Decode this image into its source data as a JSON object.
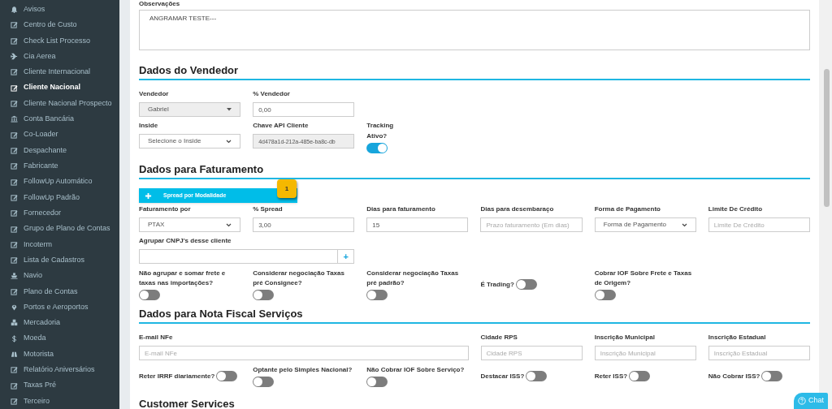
{
  "sidebar": {
    "items": [
      {
        "label": "Avisos",
        "kind": "bell",
        "selected": false
      },
      {
        "label": "Centro de Custo",
        "kind": "edit",
        "selected": false
      },
      {
        "label": "Check List Processo",
        "kind": "edit",
        "selected": false
      },
      {
        "label": "Cia Aerea",
        "kind": "plane",
        "selected": false
      },
      {
        "label": "Cliente Internacional",
        "kind": "edit",
        "selected": false
      },
      {
        "label": "Cliente Nacional",
        "kind": "edit",
        "selected": true
      },
      {
        "label": "Cliente Nacional Prospecto",
        "kind": "edit",
        "selected": false
      },
      {
        "label": "Conta Bancária",
        "kind": "bank",
        "selected": false
      },
      {
        "label": "Co-Loader",
        "kind": "edit",
        "selected": false
      },
      {
        "label": "Despachante",
        "kind": "edit",
        "selected": false
      },
      {
        "label": "Fabricante",
        "kind": "edit",
        "selected": false
      },
      {
        "label": "FollowUp Automático",
        "kind": "edit",
        "selected": false
      },
      {
        "label": "FollowUp Padrão",
        "kind": "edit",
        "selected": false
      },
      {
        "label": "Fornecedor",
        "kind": "edit",
        "selected": false
      },
      {
        "label": "Grupo de Plano de Contas",
        "kind": "edit",
        "selected": false
      },
      {
        "label": "Incoterm",
        "kind": "edit",
        "selected": false
      },
      {
        "label": "Lista de Cadastros",
        "kind": "edit",
        "selected": false
      },
      {
        "label": "Navio",
        "kind": "ship",
        "selected": false
      },
      {
        "label": "Plano de Contas",
        "kind": "edit",
        "selected": false
      },
      {
        "label": "Portos e Aeroportos",
        "kind": "pin",
        "selected": false
      },
      {
        "label": "Mercadoria",
        "kind": "cubes",
        "selected": false
      },
      {
        "label": "Moeda",
        "kind": "dollar",
        "selected": false
      },
      {
        "label": "Motorista",
        "kind": "binoculars",
        "selected": false
      },
      {
        "label": "Relatório Aniversários",
        "kind": "edit",
        "selected": false
      },
      {
        "label": "Taxas Pré",
        "kind": "edit",
        "selected": false
      },
      {
        "label": "Terceiro",
        "kind": "edit",
        "selected": false
      }
    ]
  },
  "observacoes": {
    "label": "Observações",
    "value": "ANGRAMAR TESTE---"
  },
  "sections": [
    {
      "title": "Dados do Vendedor",
      "rows": [
        [
          {
            "kind": "select",
            "label": "Vendedor",
            "value": "Gabriel",
            "disabled": true
          },
          {
            "kind": "input",
            "label": "% Vendedor",
            "value": "0,00",
            "disabled": false
          }
        ],
        [
          {
            "kind": "select",
            "label": "Inside",
            "value": "Selecione o Inside",
            "disabled": false
          },
          {
            "kind": "input",
            "label": "Chave API Cliente",
            "value": "4d478a1d-212a-485e-ba8c-db",
            "disabled": true
          },
          {
            "kind": "toggle",
            "label": "Tracking Ativo?",
            "on": true
          }
        ]
      ]
    },
    {
      "title": "Dados para Faturamento",
      "button": {
        "label": "Spread por Modalidade",
        "badge": "1"
      },
      "rows": [
        [
          {
            "kind": "select",
            "label": "Faturamento por",
            "value": "PTAX",
            "disabled": false
          },
          {
            "kind": "input",
            "label": "% Spread",
            "value": "3,00",
            "disabled": false
          },
          {
            "kind": "input",
            "label": "Dias para faturamento",
            "value": "15",
            "disabled": false
          },
          {
            "kind": "input",
            "label": "Dias para desembaraço",
            "placeholder": "Prazo faturamento (Em dias)",
            "disabled": false
          },
          {
            "kind": "select",
            "label": "Forma de Pagamento",
            "value": "Forma de Pagamento",
            "disabled": false
          },
          {
            "kind": "input",
            "label": "Limite De Crédito",
            "placeholder": "Limite De Crédito",
            "disabled": false
          }
        ],
        [
          {
            "kind": "addon",
            "label": "Agrupar CNPJ's desse cliente",
            "addon": "+"
          }
        ],
        [
          {
            "kind": "toggle",
            "label": "Não agrupar e somar frete e taxas nas importações?",
            "on": false
          },
          {
            "kind": "toggle",
            "label": "Considerar negociação Taxas pré Consignee?",
            "on": false
          },
          {
            "kind": "toggle",
            "label": "Considerar negociação Taxas pré padrão?",
            "on": false
          },
          {
            "kind": "toggle-inline",
            "label": "É Trading?",
            "on": false
          },
          {
            "kind": "toggle",
            "label": "Cobrar IOF Sobre Frete e Taxas de Origem?",
            "on": false
          }
        ]
      ]
    },
    {
      "title": "Dados para Nota Fiscal Serviços",
      "rows": [
        [
          {
            "kind": "input",
            "label": "E-mail NFe",
            "placeholder": "E-mail NFe",
            "disabled": false
          },
          "",
          "",
          {
            "kind": "input",
            "label": "Cidade RPS",
            "placeholder": "Cidade RPS",
            "disabled": false
          },
          {
            "kind": "input",
            "label": "Inscrição Municipal",
            "placeholder": "Inscrição Municipal",
            "disabled": false
          },
          {
            "kind": "input",
            "label": "Inscrição Estadual",
            "placeholder": "Inscrição Estadual",
            "disabled": false
          }
        ],
        [
          {
            "kind": "toggle-inline",
            "label": "Reter IRRF diariamente?",
            "on": false
          },
          {
            "kind": "toggle",
            "label": "Optante pelo Simples Nacional?",
            "on": false
          },
          {
            "kind": "toggle",
            "label": "Não Cobrar IOF Sobre Serviço?",
            "on": false
          },
          {
            "kind": "toggle-inline",
            "label": "Destacar ISS?",
            "on": false
          },
          {
            "kind": "toggle-inline",
            "label": "Reter ISS?",
            "on": false
          },
          {
            "kind": "toggle-inline",
            "label": "Não Cobrar ISS?",
            "on": false
          }
        ]
      ]
    },
    {
      "title": "Customer Services"
    }
  ],
  "chat_button": {
    "label": "Chat"
  }
}
